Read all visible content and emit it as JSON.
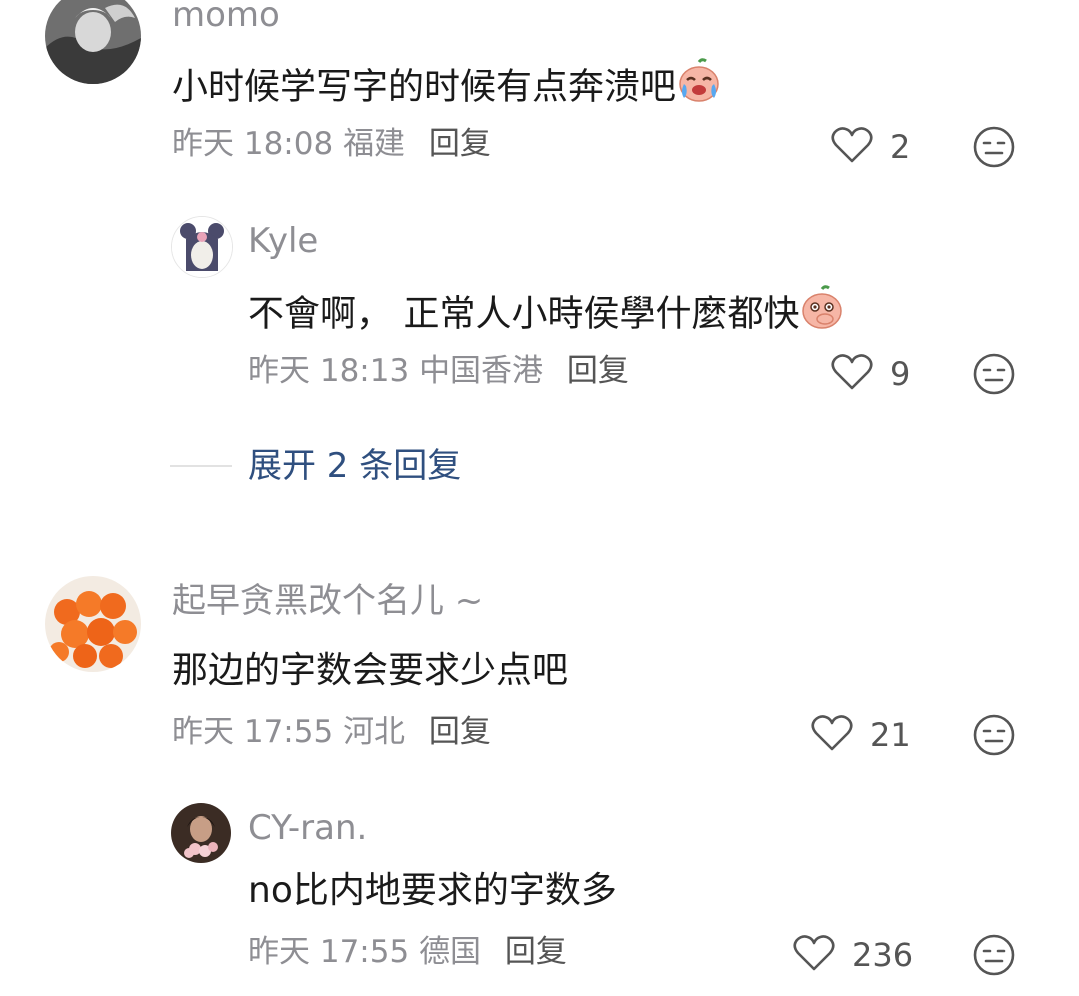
{
  "comments": [
    {
      "username": "momo",
      "content": "小时候学写字的时候有点奔溃吧",
      "content_emoji": "crying-face-emoji",
      "time": "昨天 18:08",
      "location": "福建",
      "reply_label": "回复",
      "likes": "2",
      "replies": [
        {
          "username": "Kyle",
          "content": "不會啊， 正常人小時侯學什麼都快",
          "content_emoji": "covering-mouth-emoji",
          "time": "昨天 18:13",
          "location": "中国香港",
          "reply_label": "回复",
          "likes": "9"
        }
      ],
      "expand_label": "展开 2 条回复"
    },
    {
      "username": "起早贪黑改个名儿 ~",
      "content": "那边的字数会要求少点吧",
      "time": "昨天 17:55",
      "location": "河北",
      "reply_label": "回复",
      "likes": "21",
      "replies": [
        {
          "username": "CY-ran.",
          "content": "no比内地要求的字数多",
          "time": "昨天 17:55",
          "location": "德国",
          "reply_label": "回复",
          "likes": "236"
        }
      ]
    }
  ],
  "colors": {
    "username": "#8e8e93",
    "content": "#1a1a1a",
    "expand_link": "#2f4f7f"
  }
}
